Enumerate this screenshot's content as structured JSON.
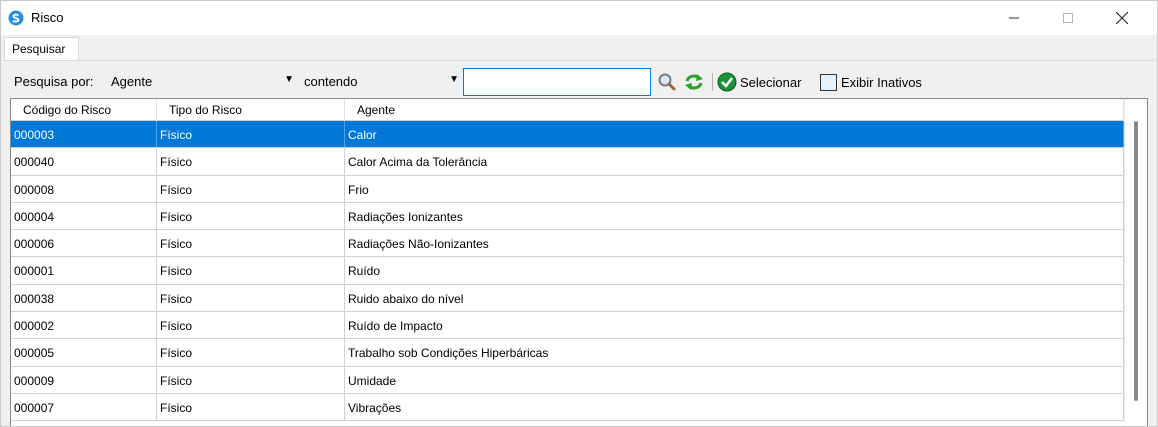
{
  "window": {
    "title": "Risco"
  },
  "tabs": [
    {
      "label": "Pesquisar"
    }
  ],
  "search": {
    "label": "Pesquisa por:",
    "field_value": "Agente",
    "operator_value": "contendo",
    "query": "",
    "select_label": "Selecionar",
    "show_inactive_label": "Exibir Inativos"
  },
  "grid": {
    "columns": [
      "Código do Risco",
      "Tipo do Risco",
      "Agente"
    ],
    "rows": [
      [
        "000003",
        "Físico",
        "Calor"
      ],
      [
        "000040",
        "Físico",
        "Calor Acima da Tolerância"
      ],
      [
        "000008",
        "Físico",
        "Frio"
      ],
      [
        "000004",
        "Físico",
        "Radiações Ionizantes"
      ],
      [
        "000006",
        "Físico",
        "Radiações Não-Ionizantes"
      ],
      [
        "000001",
        "Físico",
        "Ruído"
      ],
      [
        "000038",
        "Físico",
        "Ruido abaixo do nível"
      ],
      [
        "000002",
        "Físico",
        "Ruído de Impacto"
      ],
      [
        "000005",
        "Físico",
        "Trabalho sob Condições Hiperbáricas"
      ],
      [
        "000009",
        "Físico",
        "Umidade"
      ],
      [
        "000007",
        "Físico",
        "Vibrações"
      ]
    ],
    "selected_row": 0
  },
  "colors": {
    "selection": "#0078d7",
    "input_border": "#0078d7"
  },
  "icons": [
    "app-icon",
    "minimize-icon",
    "maximize-icon",
    "close-icon",
    "search-icon",
    "refresh-icon",
    "check-icon",
    "dropdown-arrow-icon"
  ]
}
